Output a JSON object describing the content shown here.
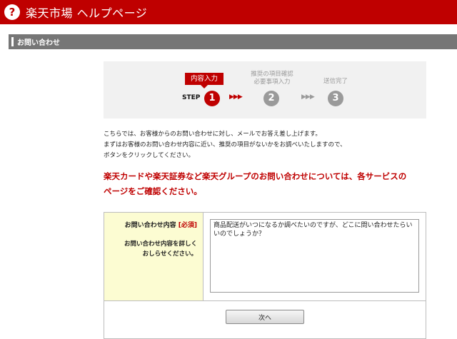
{
  "header": {
    "title": "楽天市場 ヘルプページ",
    "icon": "help-icon"
  },
  "section": {
    "title": "お問い合わせ"
  },
  "steps": {
    "step_word": "STEP",
    "items": [
      {
        "number": "1",
        "label": "内容入力",
        "state": "active",
        "color": "#bf0000"
      },
      {
        "number": "2",
        "label_line1": "推奨の項目確認",
        "label_line2": "必要事項入力",
        "state": "inactive",
        "color": "#9a9a9a"
      },
      {
        "number": "3",
        "label": "送信完了",
        "state": "inactive",
        "color": "#9a9a9a"
      }
    ],
    "arrow": "▶▶▶"
  },
  "intro": {
    "line1": "こちらでは、お客様からのお問い合わせに対し、メールでお答え差し上げます。",
    "line2": "まずはお客様のお問い合わせ内容に近い、推奨の項目がないかをお調べいたしますので、",
    "line3": "ボタンをクリックしてください。"
  },
  "notice": {
    "line1": "楽天カードや楽天証券など楽天グループのお問い合わせについては、各サービスの",
    "line2": "ページをご確認ください。"
  },
  "form": {
    "label": "お問い合わせ内容",
    "required": "[必須]",
    "help_line1": "お問い合わせ内容を詳しく",
    "help_line2": "おしらせください。",
    "textarea_value": "商品配送がいつになるか調べたいのですが、どこに問い合わせたらいいのでしょうか？",
    "next_label": "次へ"
  },
  "colors": {
    "brand": "#bf0000",
    "section": "#767676",
    "label_bg": "#fcfcd2"
  }
}
